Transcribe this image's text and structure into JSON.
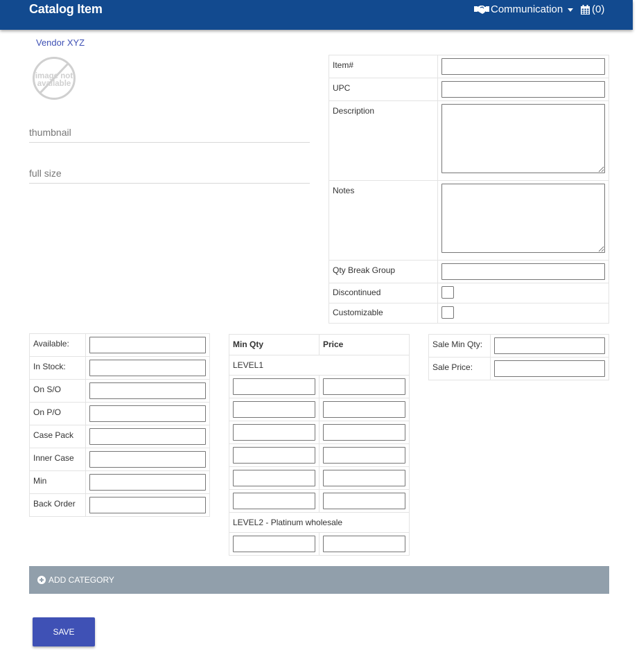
{
  "header": {
    "title": "Catalog Item",
    "communication_label": "Communication",
    "calendar_count": "(0)",
    "bg_color": "#124a8f"
  },
  "vendor_link": "Vendor XYZ",
  "image_placeholder": {
    "icon": "image-not-available-icon",
    "line1": "image not",
    "line2": "available"
  },
  "thumbnail": {
    "placeholder": "thumbnail",
    "value": ""
  },
  "fullsize": {
    "placeholder": "full size",
    "value": ""
  },
  "item_fields": {
    "item_no": "Item#",
    "upc": "UPC",
    "description": "Description",
    "notes": "Notes",
    "qty_break_group": "Qty Break Group",
    "discontinued": "Discontinued",
    "customizable": "Customizable"
  },
  "stock_fields": {
    "available": "Available:",
    "in_stock": "In Stock:",
    "on_so": "On S/O",
    "on_po": "On P/O",
    "case_pack": "Case Pack",
    "inner_case": "Inner Case",
    "min": "Min",
    "back_order": "Back Order"
  },
  "pricing": {
    "col_min_qty": "Min Qty",
    "col_price": "Price",
    "level1": "LEVEL1",
    "level2": "LEVEL2 - Platinum wholesale"
  },
  "sale": {
    "min_qty": "Sale Min Qty:",
    "price": "Sale Price:"
  },
  "add_category": "ADD CATEGORY",
  "save_label": "SAVE",
  "colors": {
    "primary": "#3f51b5",
    "add_category_bar": "#919fab"
  }
}
